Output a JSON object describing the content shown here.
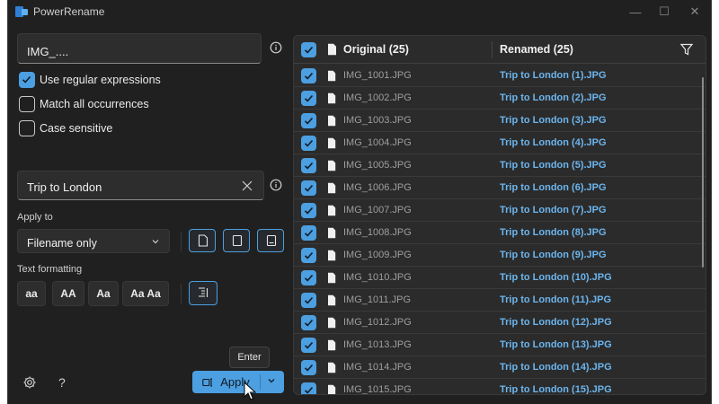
{
  "window": {
    "title": "PowerRename",
    "controls": [
      "minimize-icon",
      "maximize-icon",
      "close-icon"
    ]
  },
  "search": {
    "value": "IMG_...."
  },
  "options": [
    {
      "label": "Use regular expressions",
      "checked": true
    },
    {
      "label": "Match all occurrences",
      "checked": false
    },
    {
      "label": "Case sensitive",
      "checked": false
    }
  ],
  "replace": {
    "value": "Trip to London"
  },
  "apply_to": {
    "label": "Apply to",
    "selected": "Filename only",
    "scope_buttons": [
      "include-files-icon",
      "include-folders-icon",
      "include-subfolders-icon"
    ]
  },
  "text_formatting": {
    "label": "Text formatting",
    "buttons": [
      "aa",
      "AA",
      "Aa",
      "Aa Aa"
    ],
    "enumerate_icon": "enumerate-items-icon"
  },
  "footer": {
    "tooltip": "Enter",
    "apply_label": "Apply",
    "settings_icon": "gear-icon",
    "help_label": "?"
  },
  "list": {
    "header_original": "Original (25)",
    "header_renamed": "Renamed (25)",
    "rows": [
      {
        "original": "IMG_1001.JPG",
        "renamed": "Trip to London (1).JPG"
      },
      {
        "original": "IMG_1002.JPG",
        "renamed": "Trip to London (2).JPG"
      },
      {
        "original": "IMG_1003.JPG",
        "renamed": "Trip to London (3).JPG"
      },
      {
        "original": "IMG_1004.JPG",
        "renamed": "Trip to London (4).JPG"
      },
      {
        "original": "IMG_1005.JPG",
        "renamed": "Trip to London (5).JPG"
      },
      {
        "original": "IMG_1006.JPG",
        "renamed": "Trip to London (6).JPG"
      },
      {
        "original": "IMG_1007.JPG",
        "renamed": "Trip to London (7).JPG"
      },
      {
        "original": "IMG_1008.JPG",
        "renamed": "Trip to London (8).JPG"
      },
      {
        "original": "IMG_1009.JPG",
        "renamed": "Trip to London (9).JPG"
      },
      {
        "original": "IMG_1010.JPG",
        "renamed": "Trip to London (10).JPG"
      },
      {
        "original": "IMG_1011.JPG",
        "renamed": "Trip to London (11).JPG"
      },
      {
        "original": "IMG_1012.JPG",
        "renamed": "Trip to London (12).JPG"
      },
      {
        "original": "IMG_1013.JPG",
        "renamed": "Trip to London (13).JPG"
      },
      {
        "original": "IMG_1014.JPG",
        "renamed": "Trip to London (14).JPG"
      },
      {
        "original": "IMG_1015.JPG",
        "renamed": "Trip to London (15).JPG"
      }
    ]
  },
  "colors": {
    "accent": "#4c9fe0",
    "renamed_text": "#6cb5ee",
    "background": "#202020"
  }
}
